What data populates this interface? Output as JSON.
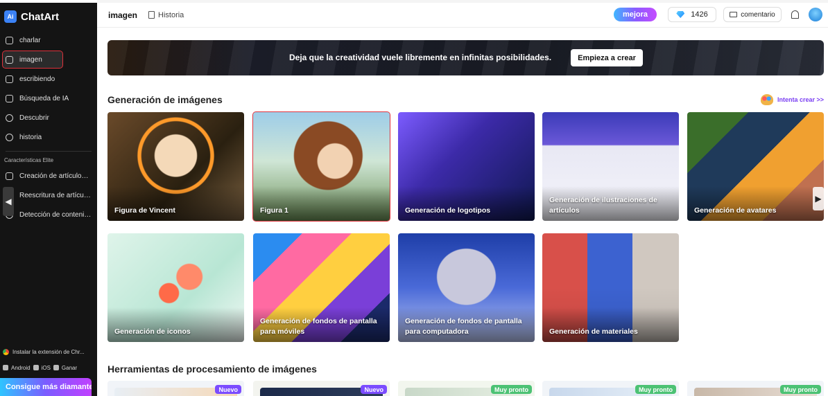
{
  "sidebar": {
    "brand": "ChatArt",
    "items": [
      {
        "label": "charlar",
        "icon": "chat-icon"
      },
      {
        "label": "imagen",
        "icon": "image-icon"
      },
      {
        "label": "escribiendo",
        "icon": "write-icon"
      },
      {
        "label": "Búsqueda de IA",
        "icon": "search-ai-icon"
      },
      {
        "label": "Descubrir",
        "icon": "compass-icon"
      },
      {
        "label": "historia",
        "icon": "history-icon"
      }
    ],
    "elite_label": "Características Elite",
    "elite_items": [
      {
        "label": "Creación de artículos ...",
        "icon": "article-icon"
      },
      {
        "label": "Reescritura de artículos",
        "icon": "rewrite-icon"
      },
      {
        "label": "Detección de contenid...",
        "icon": "detect-icon"
      }
    ],
    "extension": "Instalar la extensión de Chr...",
    "platforms": {
      "android": "Android",
      "ios": "iOS",
      "windows": "Ganar"
    },
    "cta": "Consigue más diamantes"
  },
  "topbar": {
    "title": "imagen",
    "history": "Historia",
    "upgrade": "mejora",
    "diamonds": "1426",
    "feedback": "comentario"
  },
  "banner": {
    "text": "Deja que la creatividad vuele libremente en infinitas posibilidades.",
    "button": "Empieza a crear"
  },
  "generation": {
    "title": "Generación de imágenes",
    "try_link": "Intenta crear >>",
    "cards": [
      {
        "label": "Figura de Vincent"
      },
      {
        "label": "Figura 1"
      },
      {
        "label": "Generación de logotipos"
      },
      {
        "label": "Generación de ilustraciones de artículos"
      },
      {
        "label": "Generación de avatares"
      },
      {
        "label": "Generación de iconos"
      },
      {
        "label": "Generación de fondos de pantalla para móviles"
      },
      {
        "label": "Generación de fondos de pantalla para computadora"
      },
      {
        "label": "Generación de materiales"
      }
    ]
  },
  "tools": {
    "title": "Herramientas de procesamiento de imágenes",
    "badges": [
      "Nuevo",
      "Nuevo",
      "Muy pronto",
      "Muy pronto",
      "Muy pronto"
    ]
  }
}
